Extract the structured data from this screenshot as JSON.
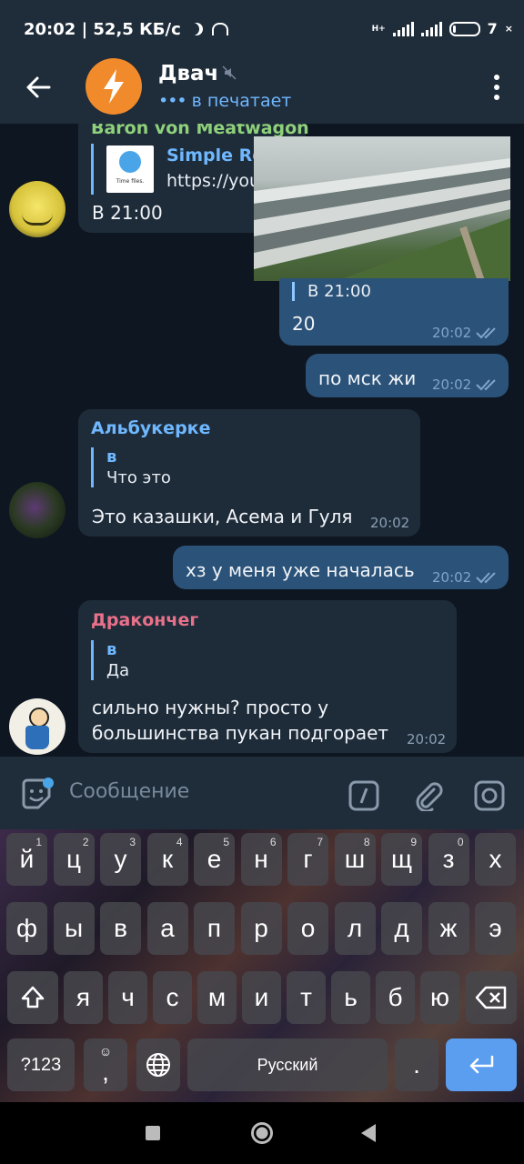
{
  "status": {
    "time": "20:02",
    "speed": "52,5 КБ/с",
    "net_badge": "H+",
    "battery": "7"
  },
  "header": {
    "title": "Двач",
    "status": "в печатает"
  },
  "messages": {
    "m1": {
      "sender": "Baron von Meatwagon",
      "link_title": "Simple Ros",
      "link_url": "https://you",
      "thumb_text": "Time files.",
      "text": "В 21:00"
    },
    "m2": {
      "reply_text": "В 21:00",
      "text": "20",
      "time": "20:02"
    },
    "m3": {
      "text": "по мск жи",
      "time": "20:02"
    },
    "m4": {
      "sender": "Альбукерке",
      "reply_name": "в",
      "reply_text": "Что это",
      "text": "Это казашки, Асема и Гуля",
      "time": "20:02"
    },
    "m5": {
      "text": "хз у меня уже началась",
      "time": "20:02"
    },
    "m6": {
      "sender": "Дракончег",
      "reply_name": "в",
      "reply_text": "Да",
      "text_line1": "сильно нужны? просто у",
      "text_line2": "большинства пукан подгорает",
      "time": "20:02"
    }
  },
  "input": {
    "placeholder": "Сообщение"
  },
  "keyboard": {
    "row1": [
      {
        "k": "й",
        "n": "1"
      },
      {
        "k": "ц",
        "n": "2"
      },
      {
        "k": "у",
        "n": "3"
      },
      {
        "k": "к",
        "n": "4"
      },
      {
        "k": "е",
        "n": "5"
      },
      {
        "k": "н",
        "n": "6"
      },
      {
        "k": "г",
        "n": "7"
      },
      {
        "k": "ш",
        "n": "8"
      },
      {
        "k": "щ",
        "n": "9"
      },
      {
        "k": "з",
        "n": "0"
      },
      {
        "k": "х",
        "n": ""
      }
    ],
    "row2": [
      "ф",
      "ы",
      "в",
      "а",
      "п",
      "р",
      "о",
      "л",
      "д",
      "ж",
      "э"
    ],
    "row3": [
      "я",
      "ч",
      "с",
      "м",
      "и",
      "т",
      "ь",
      "б",
      "ю"
    ],
    "sym": "?123",
    "comma": ",",
    "space": "Русский",
    "period": "."
  },
  "colors": {
    "accent": "#6fb8ff",
    "in_bubble": "#1e2c3a",
    "out_bubble": "#2b5278",
    "sender_green": "#8fd17a",
    "sender_blue": "#6fb8ff",
    "sender_red": "#e8718a"
  }
}
